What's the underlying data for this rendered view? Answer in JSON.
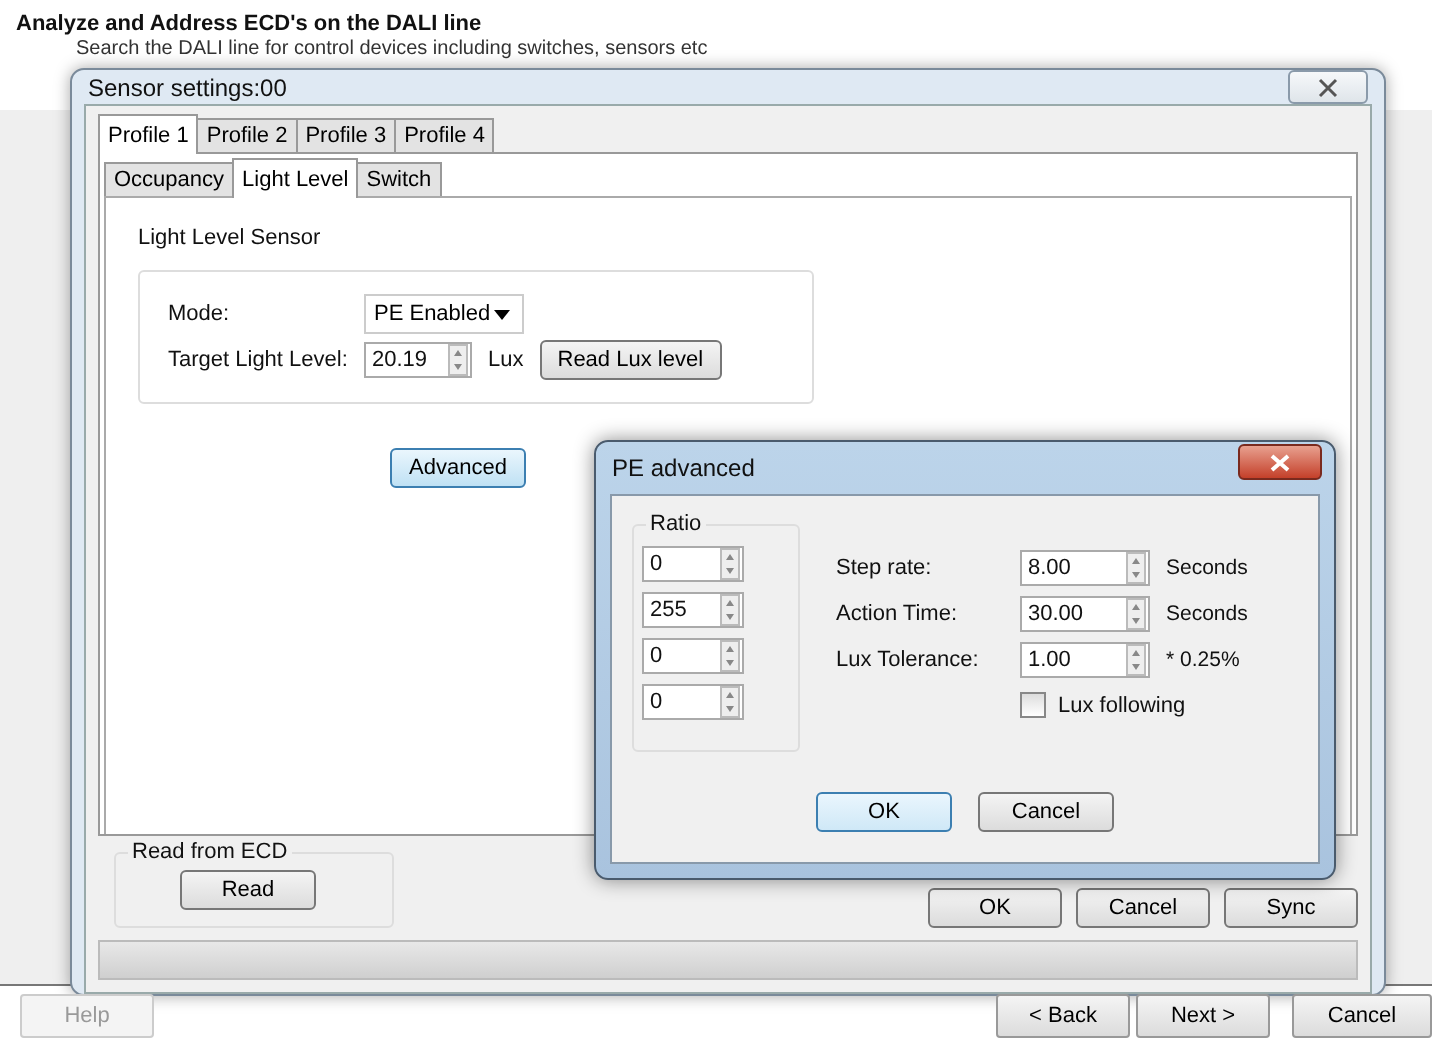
{
  "page": {
    "title": "Analyze and Address ECD's on the DALI line",
    "subtitle": "Search the DALI line for control devices including switches, sensors etc"
  },
  "sensor_window": {
    "title": "Sensor settings:00",
    "profile_tabs": [
      {
        "label": "Profile 1",
        "selected": true
      },
      {
        "label": "Profile 2",
        "selected": false
      },
      {
        "label": "Profile 3",
        "selected": false
      },
      {
        "label": "Profile 4",
        "selected": false
      }
    ],
    "sub_tabs": [
      {
        "label": "Occupancy",
        "selected": false
      },
      {
        "label": "Light Level",
        "selected": true
      },
      {
        "label": "Switch",
        "selected": false
      }
    ],
    "section_title": "Light Level Sensor",
    "mode": {
      "label": "Mode:",
      "value": "PE Enabled"
    },
    "target": {
      "label": "Target Light Level:",
      "value": "20.19",
      "unit": "Lux",
      "button": "Read Lux level"
    },
    "advanced_button": "Advanced",
    "read_group": {
      "title": "Read from ECD",
      "button": "Read"
    },
    "buttons": [
      "OK",
      "Cancel",
      "Sync"
    ],
    "progress": {
      "level": 0
    }
  },
  "pe_dialog": {
    "title": "PE advanced",
    "ratio": {
      "title": "Ratio",
      "values": [
        "0",
        "255",
        "0",
        "0"
      ]
    },
    "settings": [
      {
        "label": "Step rate:",
        "value": "8.00",
        "unit": "Seconds"
      },
      {
        "label": "Action Time:",
        "value": "30.00",
        "unit": "Seconds"
      },
      {
        "label": "Lux Tolerance:",
        "value": "1.00",
        "unit": "* 0.25%"
      }
    ],
    "lux_following": {
      "label": "Lux following",
      "checked": false
    },
    "buttons": [
      "OK",
      "Cancel"
    ]
  },
  "wizard": {
    "help": {
      "label": "Help",
      "disabled": true
    },
    "buttons": [
      "< Back",
      "Next >",
      "Cancel"
    ]
  }
}
